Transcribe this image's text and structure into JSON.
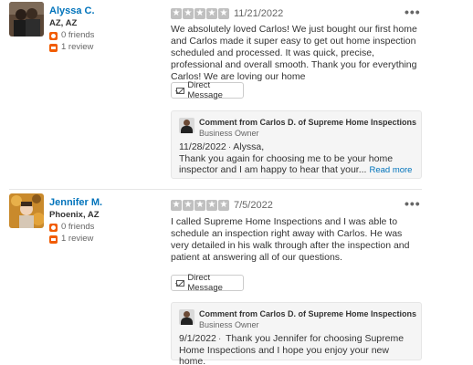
{
  "reviews": [
    {
      "user": {
        "name": "Alyssa C.",
        "location": "AZ, AZ",
        "friends": "0 friends",
        "reviews": "1 review"
      },
      "rating": 5,
      "date": "11/21/2022",
      "text": "We absolutely loved Carlos! We just bought our first home and Carlos made it super easy to get out home inspection scheduled and processed. It was quick, precise, professional and overall smooth. Thank you for everything Carlos! We are loving our home",
      "direct_message_label": "Direct Message",
      "comment": {
        "from": "Comment from Carlos D. of Supreme Home Inspections",
        "role": "Business Owner",
        "date": "11/28/2022",
        "separator": "·",
        "greeting": "Alyssa,",
        "text": "Thank you again for choosing me to be your home inspector and I am happy to hear that your...",
        "read_more": "Read more"
      }
    },
    {
      "user": {
        "name": "Jennifer M.",
        "location": "Phoenix, AZ",
        "friends": "0 friends",
        "reviews": "1 review"
      },
      "rating": 5,
      "date": "7/5/2022",
      "text": "I called Supreme Home Inspections and I was able to schedule an inspection right away with Carlos. He was very detailed in his walk through after the inspection and patient at answering all of our questions.",
      "direct_message_label": "Direct Message",
      "comment": {
        "from": "Comment from Carlos D. of Supreme Home Inspections",
        "role": "Business Owner",
        "date": "9/1/2022",
        "separator": "·",
        "text": "Thank you Jennifer for choosing Supreme Home Inspections and I hope you enjoy your new home."
      }
    }
  ],
  "menu_dots": "•••",
  "star_glyph": "★",
  "colors": {
    "link": "#0073bb",
    "star_empty": "#c0c0c0",
    "stat_icon": "#f15c00",
    "comment_bg": "#f5f5f5"
  }
}
